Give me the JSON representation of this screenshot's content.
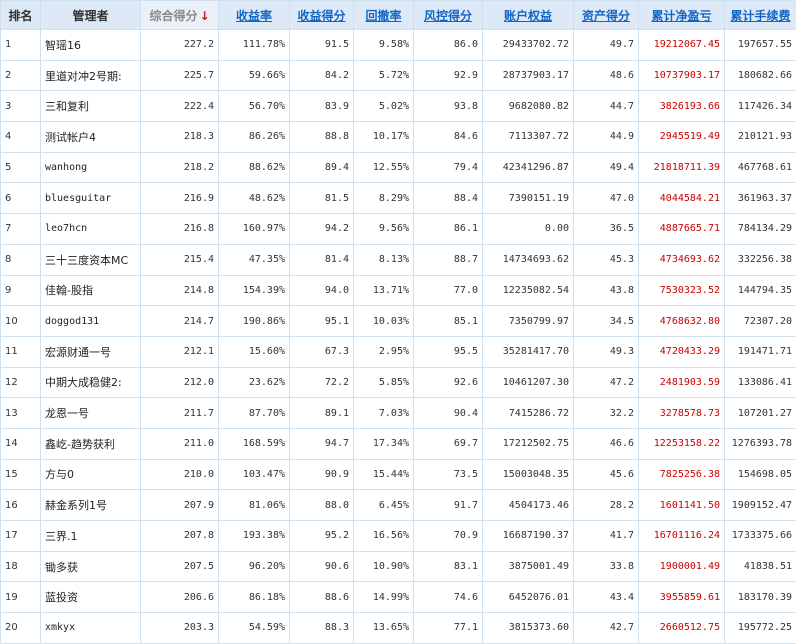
{
  "table": {
    "headers": [
      {
        "label": "排名",
        "link": false
      },
      {
        "label": "管理者",
        "link": false
      },
      {
        "label": "综合得分",
        "link": false,
        "sorted": true,
        "sort_icon": "sort-down-arrow-icon"
      },
      {
        "label": "收益率",
        "link": true
      },
      {
        "label": "收益得分",
        "link": true
      },
      {
        "label": "回撤率",
        "link": true
      },
      {
        "label": "风控得分",
        "link": true
      },
      {
        "label": "账户权益",
        "link": true
      },
      {
        "label": "资产得分",
        "link": true
      },
      {
        "label": "累计净盈亏",
        "link": true
      },
      {
        "label": "累计手续费",
        "link": true
      }
    ],
    "sort_arrow": "↓",
    "pnl_color": "#cc0000",
    "link_color": "#1565c4",
    "rows": [
      {
        "rank": "1",
        "name": "智瑶16",
        "score": "227.2",
        "return_rate": "111.78%",
        "return_score": "91.5",
        "drawdown": "9.58%",
        "risk_score": "86.0",
        "equity": "29433702.72",
        "asset_score": "49.7",
        "net_pnl": "19212067.45",
        "fees": "197657.55"
      },
      {
        "rank": "2",
        "name": "里道对冲2号期:",
        "score": "225.7",
        "return_rate": "59.66%",
        "return_score": "84.2",
        "drawdown": "5.72%",
        "risk_score": "92.9",
        "equity": "28737903.17",
        "asset_score": "48.6",
        "net_pnl": "10737903.17",
        "fees": "180682.66"
      },
      {
        "rank": "3",
        "name": "三和复利",
        "score": "222.4",
        "return_rate": "56.70%",
        "return_score": "83.9",
        "drawdown": "5.02%",
        "risk_score": "93.8",
        "equity": "9682080.82",
        "asset_score": "44.7",
        "net_pnl": "3826193.66",
        "fees": "117426.34"
      },
      {
        "rank": "4",
        "name": "测试帐户4",
        "score": "218.3",
        "return_rate": "86.26%",
        "return_score": "88.8",
        "drawdown": "10.17%",
        "risk_score": "84.6",
        "equity": "7113307.72",
        "asset_score": "44.9",
        "net_pnl": "2945519.49",
        "fees": "210121.93"
      },
      {
        "rank": "5",
        "name": "wanhong",
        "score": "218.2",
        "return_rate": "88.62%",
        "return_score": "89.4",
        "drawdown": "12.55%",
        "risk_score": "79.4",
        "equity": "42341296.87",
        "asset_score": "49.4",
        "net_pnl": "21818711.39",
        "fees": "467768.61"
      },
      {
        "rank": "6",
        "name": "bluesguitar",
        "score": "216.9",
        "return_rate": "48.62%",
        "return_score": "81.5",
        "drawdown": "8.29%",
        "risk_score": "88.4",
        "equity": "7390151.19",
        "asset_score": "47.0",
        "net_pnl": "4044584.21",
        "fees": "361963.37"
      },
      {
        "rank": "7",
        "name": "leo7hcn",
        "score": "216.8",
        "return_rate": "160.97%",
        "return_score": "94.2",
        "drawdown": "9.56%",
        "risk_score": "86.1",
        "equity": "0.00",
        "asset_score": "36.5",
        "net_pnl": "4887665.71",
        "fees": "784134.29"
      },
      {
        "rank": "8",
        "name": "三十三度资本MC",
        "score": "215.4",
        "return_rate": "47.35%",
        "return_score": "81.4",
        "drawdown": "8.13%",
        "risk_score": "88.7",
        "equity": "14734693.62",
        "asset_score": "45.3",
        "net_pnl": "4734693.62",
        "fees": "332256.38"
      },
      {
        "rank": "9",
        "name": "佳翰-股指",
        "score": "214.8",
        "return_rate": "154.39%",
        "return_score": "94.0",
        "drawdown": "13.71%",
        "risk_score": "77.0",
        "equity": "12235082.54",
        "asset_score": "43.8",
        "net_pnl": "7530323.52",
        "fees": "144794.35"
      },
      {
        "rank": "10",
        "name": "doggod131",
        "score": "214.7",
        "return_rate": "190.86%",
        "return_score": "95.1",
        "drawdown": "10.03%",
        "risk_score": "85.1",
        "equity": "7350799.97",
        "asset_score": "34.5",
        "net_pnl": "4768632.80",
        "fees": "72307.20"
      },
      {
        "rank": "11",
        "name": "宏源财通一号",
        "score": "212.1",
        "return_rate": "15.60%",
        "return_score": "67.3",
        "drawdown": "2.95%",
        "risk_score": "95.5",
        "equity": "35281417.70",
        "asset_score": "49.3",
        "net_pnl": "4720433.29",
        "fees": "191471.71"
      },
      {
        "rank": "12",
        "name": "中期大成稳健2:",
        "score": "212.0",
        "return_rate": "23.62%",
        "return_score": "72.2",
        "drawdown": "5.85%",
        "risk_score": "92.6",
        "equity": "10461207.30",
        "asset_score": "47.2",
        "net_pnl": "2481903.59",
        "fees": "133086.41"
      },
      {
        "rank": "13",
        "name": "龙恩一号",
        "score": "211.7",
        "return_rate": "87.70%",
        "return_score": "89.1",
        "drawdown": "7.03%",
        "risk_score": "90.4",
        "equity": "7415286.72",
        "asset_score": "32.2",
        "net_pnl": "3278578.73",
        "fees": "107201.27"
      },
      {
        "rank": "14",
        "name": "鑫屹-趋势获利",
        "score": "211.0",
        "return_rate": "168.59%",
        "return_score": "94.7",
        "drawdown": "17.34%",
        "risk_score": "69.7",
        "equity": "17212502.75",
        "asset_score": "46.6",
        "net_pnl": "12253158.22",
        "fees": "1276393.78"
      },
      {
        "rank": "15",
        "name": "方与0",
        "score": "210.0",
        "return_rate": "103.47%",
        "return_score": "90.9",
        "drawdown": "15.44%",
        "risk_score": "73.5",
        "equity": "15003048.35",
        "asset_score": "45.6",
        "net_pnl": "7825256.38",
        "fees": "154698.05"
      },
      {
        "rank": "16",
        "name": "赫金系列1号",
        "score": "207.9",
        "return_rate": "81.06%",
        "return_score": "88.0",
        "drawdown": "6.45%",
        "risk_score": "91.7",
        "equity": "4504173.46",
        "asset_score": "28.2",
        "net_pnl": "1601141.50",
        "fees": "1909152.47"
      },
      {
        "rank": "17",
        "name": "三界.1",
        "score": "207.8",
        "return_rate": "193.38%",
        "return_score": "95.2",
        "drawdown": "16.56%",
        "risk_score": "70.9",
        "equity": "16687190.37",
        "asset_score": "41.7",
        "net_pnl": "16701116.24",
        "fees": "1733375.66"
      },
      {
        "rank": "18",
        "name": "锄多获",
        "score": "207.5",
        "return_rate": "96.20%",
        "return_score": "90.6",
        "drawdown": "10.90%",
        "risk_score": "83.1",
        "equity": "3875001.49",
        "asset_score": "33.8",
        "net_pnl": "1900001.49",
        "fees": "41838.51"
      },
      {
        "rank": "19",
        "name": "蓝投资",
        "score": "206.6",
        "return_rate": "86.18%",
        "return_score": "88.6",
        "drawdown": "14.99%",
        "risk_score": "74.6",
        "equity": "6452076.01",
        "asset_score": "43.4",
        "net_pnl": "3955859.61",
        "fees": "183170.39"
      },
      {
        "rank": "20",
        "name": "xmkyx",
        "score": "203.3",
        "return_rate": "54.59%",
        "return_score": "88.3",
        "drawdown": "13.65%",
        "risk_score": "77.1",
        "equity": "3815373.60",
        "asset_score": "42.7",
        "net_pnl": "2660512.75",
        "fees": "195772.25"
      }
    ]
  }
}
